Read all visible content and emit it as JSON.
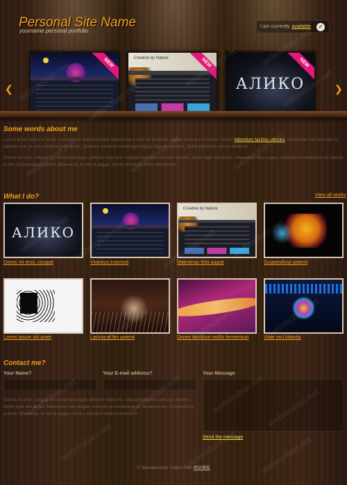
{
  "header": {
    "title": "Personal Site Name",
    "subtitle": "yourname personal portfolio",
    "availability": {
      "prefix": "I am currently",
      "status": "available"
    }
  },
  "showcase": {
    "prev_glyph": "❮",
    "next_glyph": "❯",
    "slides": [
      {
        "style": "dark",
        "badge": "NEW"
      },
      {
        "style": "creative",
        "badge": "NEW",
        "shot_text": "Creative by Nature"
      },
      {
        "style": "aliko",
        "badge": "NEW",
        "shot_text": "АЛИКО"
      }
    ]
  },
  "about": {
    "title": "Some words about me",
    "p1_before": "Lorem ipsum dolor sit amet, consectetur adipiscing elit. Maecenas a urna sit amet leo sagittis cursus a id lectus. Donec ",
    "p1_link": "bibendum facilisis ultricies",
    "p1_after": ". Maecenas nisl arcu dui, ut lobortis erat. In nec condimentum quam. Vivamus euismod scelerisque ligula vitae fermentum. Nulla dignissim rutrum eleifend.",
    "p2": "Donec mi eros, congue ut consectetur eget, pretium vitae orci. Aliquam pharetra ultricies lobortis. Morbi eget nisl lectus. Maecenas felis augue, molestie et vestibulum et, lacinia et leo. Suspendisse potenti. Maecenas at nisl et augue. Donec tincidunt mollis fermentum."
  },
  "work": {
    "title": "What I do?",
    "view_all": "View all works",
    "items": [
      {
        "caption": "Donec mi eros, congue",
        "style": "aliko",
        "shot_text": "АЛИКО"
      },
      {
        "caption": "Vivamus euismod",
        "style": "dark"
      },
      {
        "caption": "Maecenas felis augue",
        "style": "creative",
        "shot_text": "Creative by Nature"
      },
      {
        "caption": "Suspendisse potenti",
        "style": "splash"
      },
      {
        "caption": "Lorem ipsum sid amet",
        "style": "sketch"
      },
      {
        "caption": "Lacinia et leo potenti",
        "style": "grass"
      },
      {
        "caption": "Donec tincidunt mollis fermentum",
        "style": "wave"
      },
      {
        "caption": "Vitae orci lobortis",
        "style": "night"
      }
    ]
  },
  "contact": {
    "title": "Contact me?",
    "name_label": "Your Name?",
    "email_label": "Your E-mail address?",
    "message_label": "Your Message",
    "text": "Donec mi eros, congue ut consectetur eget, pretium vitae orci. Aliquam pharetra ultricies lobortis. Morbi eget nisl lectus. Maecenas felis augue, molestie et vestibulum et, lacinia et leo. Suspendisse potenti. Maecenas at nisl et augue. Donec tincidunt mollis fermentum.",
    "send_label": "Send the message"
  },
  "footer": {
    "copyright": "© Sitename.com. Collect from",
    "link": "网站模板"
  },
  "watermark": "webmoban.net",
  "colors": {
    "accent": "#f0a020",
    "link": "#f0d34a",
    "badge": "#e2187a"
  }
}
